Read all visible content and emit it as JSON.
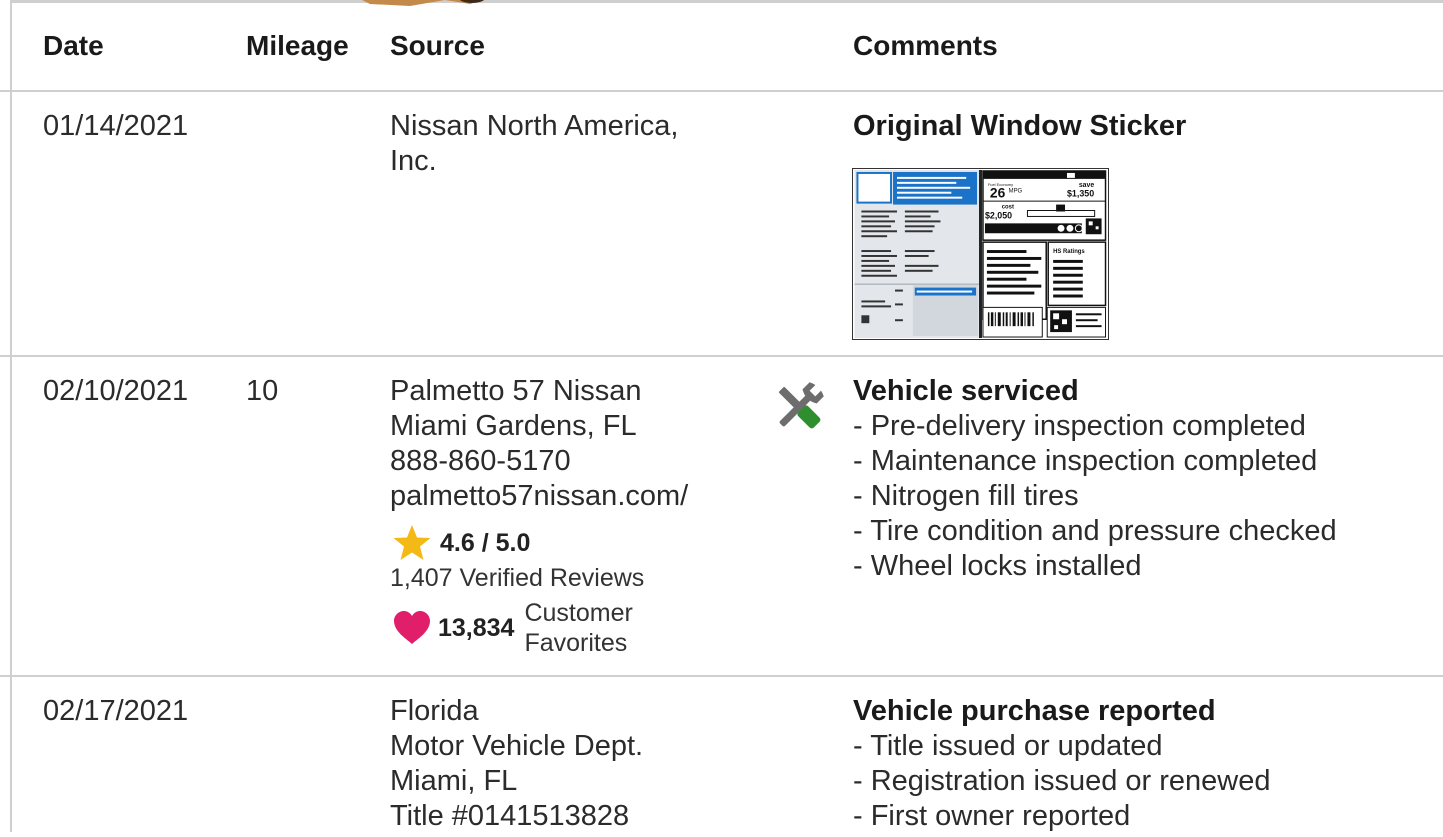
{
  "header": {
    "date": "Date",
    "mileage": "Mileage",
    "source": "Source",
    "comments": "Comments"
  },
  "rows": [
    {
      "date": "01/14/2021",
      "mileage": "",
      "source_lines": [
        "Nissan North America,",
        "Inc."
      ],
      "comment_title": "Original Window Sticker",
      "sticker": {
        "mpg": "26",
        "mpg_unit": "MPG",
        "save_label": "save",
        "save": "$1,350",
        "cost_label": "cost",
        "cost": "$2,050",
        "ratings_label": "HS Ratings"
      }
    },
    {
      "date": "02/10/2021",
      "mileage": "10",
      "source_lines": [
        "Palmetto 57 Nissan",
        "Miami Gardens, FL",
        "888-860-5170",
        "palmetto57nissan.com/"
      ],
      "rating": "4.6 / 5.0",
      "reviews": "1,407 Verified Reviews",
      "favorites_count": "13,834",
      "favorites_label_1": "Customer",
      "favorites_label_2": "Favorites",
      "service_icon": "wrench-screwdriver-icon",
      "comment_title": "Vehicle serviced",
      "comment_items": [
        "- Pre-delivery inspection completed",
        "- Maintenance inspection completed",
        "- Nitrogen fill tires",
        "- Tire condition and pressure checked",
        "- Wheel locks installed"
      ]
    },
    {
      "date": "02/17/2021",
      "mileage": "",
      "source_lines": [
        "Florida",
        "Motor Vehicle Dept.",
        "Miami, FL",
        "Title #0141513828"
      ],
      "comment_title": "Vehicle purchase reported",
      "comment_items": [
        "- Title issued or updated",
        "- Registration issued or renewed",
        "- First owner reported"
      ]
    }
  ],
  "colors": {
    "star": "#f5b915",
    "heart": "#e01e6a",
    "sticker_blue": "#1a73c8",
    "icon_gray": "#6d6d6d",
    "icon_green": "#2f8f2f"
  }
}
